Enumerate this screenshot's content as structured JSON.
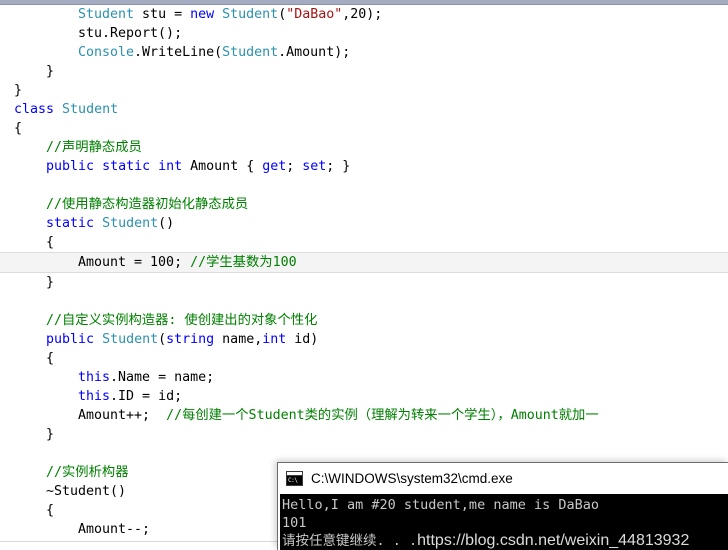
{
  "editor": {
    "lines": [
      {
        "indent": 8,
        "tokens": [
          {
            "t": "Student",
            "c": "typ"
          },
          {
            "t": " stu = ",
            "c": "pln"
          },
          {
            "t": "new",
            "c": "kw"
          },
          {
            "t": " ",
            "c": "pln"
          },
          {
            "t": "Student",
            "c": "typ"
          },
          {
            "t": "(",
            "c": "pln"
          },
          {
            "t": "\"DaBao\"",
            "c": "str"
          },
          {
            "t": ",20);",
            "c": "pln"
          }
        ]
      },
      {
        "indent": 8,
        "tokens": [
          {
            "t": "stu.Report();",
            "c": "pln"
          }
        ]
      },
      {
        "indent": 8,
        "tokens": [
          {
            "t": "Console",
            "c": "typ"
          },
          {
            "t": ".WriteLine(",
            "c": "pln"
          },
          {
            "t": "Student",
            "c": "typ"
          },
          {
            "t": ".Amount);",
            "c": "pln"
          }
        ]
      },
      {
        "indent": 4,
        "tokens": [
          {
            "t": "}",
            "c": "pln"
          }
        ]
      },
      {
        "indent": 0,
        "tokens": [
          {
            "t": "}",
            "c": "pln"
          }
        ]
      },
      {
        "indent": 0,
        "tokens": [
          {
            "t": "class",
            "c": "kw"
          },
          {
            "t": " ",
            "c": "pln"
          },
          {
            "t": "Student",
            "c": "typ"
          }
        ]
      },
      {
        "indent": 0,
        "tokens": [
          {
            "t": "{",
            "c": "pln"
          }
        ]
      },
      {
        "indent": 4,
        "tokens": [
          {
            "t": "//声明静态成员",
            "c": "cmt"
          }
        ]
      },
      {
        "indent": 4,
        "tokens": [
          {
            "t": "public",
            "c": "kw"
          },
          {
            "t": " ",
            "c": "pln"
          },
          {
            "t": "static",
            "c": "kw"
          },
          {
            "t": " ",
            "c": "pln"
          },
          {
            "t": "int",
            "c": "kw"
          },
          {
            "t": " Amount { ",
            "c": "pln"
          },
          {
            "t": "get",
            "c": "kw"
          },
          {
            "t": "; ",
            "c": "pln"
          },
          {
            "t": "set",
            "c": "kw"
          },
          {
            "t": "; }",
            "c": "pln"
          }
        ]
      },
      {
        "indent": 4,
        "tokens": [
          {
            "t": "",
            "c": "pln"
          }
        ]
      },
      {
        "indent": 4,
        "tokens": [
          {
            "t": "//使用静态构造器初始化静态成员",
            "c": "cmt"
          }
        ]
      },
      {
        "indent": 4,
        "tokens": [
          {
            "t": "static",
            "c": "kw"
          },
          {
            "t": " ",
            "c": "pln"
          },
          {
            "t": "Student",
            "c": "typ"
          },
          {
            "t": "()",
            "c": "pln"
          }
        ]
      },
      {
        "indent": 4,
        "tokens": [
          {
            "t": "{",
            "c": "pln"
          }
        ]
      },
      {
        "indent": 8,
        "highlight": true,
        "tokens": [
          {
            "t": "Amount = 100; ",
            "c": "pln"
          },
          {
            "t": "//学生基数为100",
            "c": "cmt"
          }
        ]
      },
      {
        "indent": 4,
        "tokens": [
          {
            "t": "}",
            "c": "pln"
          }
        ]
      },
      {
        "indent": 4,
        "tokens": [
          {
            "t": "",
            "c": "pln"
          }
        ]
      },
      {
        "indent": 4,
        "tokens": [
          {
            "t": "//自定义实例构造器: 使创建出的对象个性化",
            "c": "cmt"
          }
        ]
      },
      {
        "indent": 4,
        "tokens": [
          {
            "t": "public",
            "c": "kw"
          },
          {
            "t": " ",
            "c": "pln"
          },
          {
            "t": "Student",
            "c": "typ"
          },
          {
            "t": "(",
            "c": "pln"
          },
          {
            "t": "string",
            "c": "kw"
          },
          {
            "t": " name,",
            "c": "pln"
          },
          {
            "t": "int",
            "c": "kw"
          },
          {
            "t": " id)",
            "c": "pln"
          }
        ]
      },
      {
        "indent": 4,
        "tokens": [
          {
            "t": "{",
            "c": "pln"
          }
        ]
      },
      {
        "indent": 8,
        "tokens": [
          {
            "t": "this",
            "c": "kw"
          },
          {
            "t": ".Name = name;",
            "c": "pln"
          }
        ]
      },
      {
        "indent": 8,
        "tokens": [
          {
            "t": "this",
            "c": "kw"
          },
          {
            "t": ".ID = id;",
            "c": "pln"
          }
        ]
      },
      {
        "indent": 8,
        "tokens": [
          {
            "t": "Amount++;  ",
            "c": "pln"
          },
          {
            "t": "//每创建一个Student类的实例（理解为转来一个学生），Amount就加一",
            "c": "cmt"
          }
        ]
      },
      {
        "indent": 4,
        "tokens": [
          {
            "t": "}",
            "c": "pln"
          }
        ]
      },
      {
        "indent": 4,
        "tokens": [
          {
            "t": "",
            "c": "pln"
          }
        ]
      },
      {
        "indent": 4,
        "tokens": [
          {
            "t": "//实例析构器",
            "c": "cmt"
          }
        ]
      },
      {
        "indent": 4,
        "tokens": [
          {
            "t": "~Student()",
            "c": "pln"
          }
        ]
      },
      {
        "indent": 4,
        "tokens": [
          {
            "t": "{",
            "c": "pln"
          }
        ]
      },
      {
        "indent": 8,
        "tokens": [
          {
            "t": "Amount--;",
            "c": "pln"
          }
        ]
      },
      {
        "indent": 4,
        "tokens": [
          {
            "t": "}",
            "c": "pln"
          }
        ]
      }
    ],
    "colors": {
      "keyword": "#0000FF",
      "type": "#2B91AF",
      "string": "#A31515",
      "comment": "#008000",
      "plain": "#000000",
      "highlight_bg": "#F4F4F4",
      "background": "#FFFFFF"
    }
  },
  "console": {
    "icon": "cmd-console-icon",
    "icon_glyph": "C:\\",
    "title": "C:\\WINDOWS\\system32\\cmd.exe",
    "output_lines": [
      "Hello,I am #20 student,me name is DaBao",
      "101"
    ],
    "prompt_line": "请按任意键继续. . .",
    "watermark": "https://blog.csdn.net/weixin_44813932",
    "colors": {
      "background": "#000000",
      "text": "#C8C8C8",
      "titlebar": "#FFFFFF"
    }
  }
}
